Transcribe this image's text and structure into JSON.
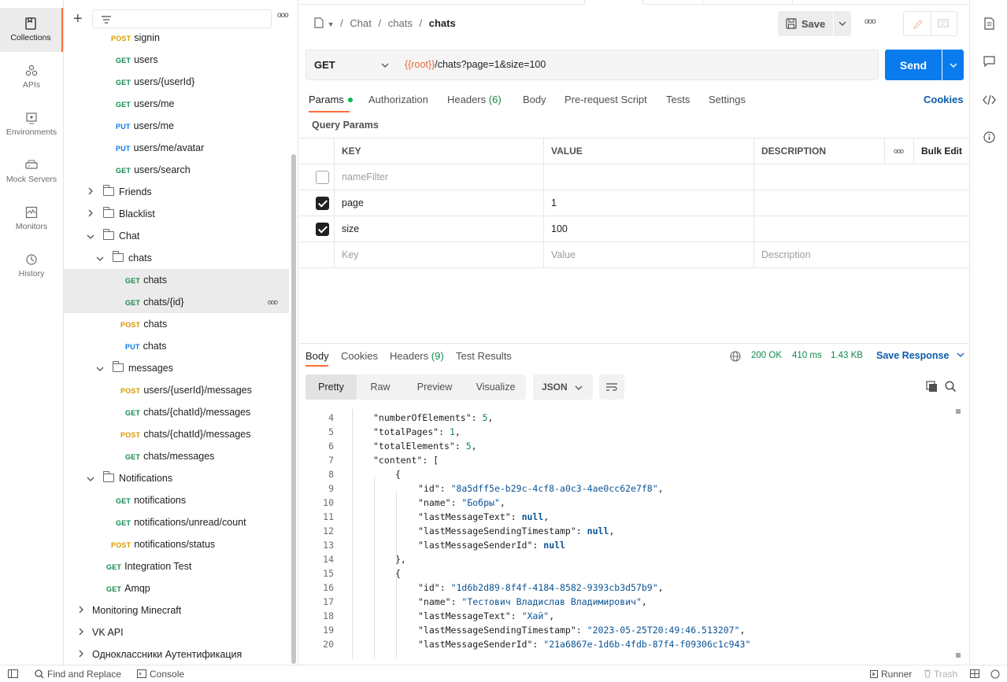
{
  "rail": [
    {
      "label": "Collections",
      "icon": "collections-icon",
      "active": true
    },
    {
      "label": "APIs",
      "icon": "apis-icon"
    },
    {
      "label": "Environments",
      "icon": "environments-icon"
    },
    {
      "label": "Mock Servers",
      "icon": "mock-servers-icon"
    },
    {
      "label": "Monitors",
      "icon": "monitors-icon"
    },
    {
      "label": "History",
      "icon": "history-icon"
    }
  ],
  "sidebar": {
    "items": [
      {
        "type": "req",
        "method": "POST",
        "name": "signin",
        "indent": 2
      },
      {
        "type": "req",
        "method": "GET",
        "name": "users",
        "indent": 2
      },
      {
        "type": "req",
        "method": "GET",
        "name": "users/{userId}",
        "indent": 2
      },
      {
        "type": "req",
        "method": "GET",
        "name": "users/me",
        "indent": 2
      },
      {
        "type": "req",
        "method": "PUT",
        "name": "users/me",
        "indent": 2
      },
      {
        "type": "req",
        "method": "PUT",
        "name": "users/me/avatar",
        "indent": 2
      },
      {
        "type": "req",
        "method": "GET",
        "name": "users/search",
        "indent": 2
      },
      {
        "type": "folder",
        "name": "Friends",
        "indent": 1,
        "open": false
      },
      {
        "type": "folder",
        "name": "Blacklist",
        "indent": 1,
        "open": false
      },
      {
        "type": "folder",
        "name": "Chat",
        "indent": 1,
        "open": true
      },
      {
        "type": "folder",
        "name": "chats",
        "indent": 2,
        "open": true
      },
      {
        "type": "req",
        "method": "GET",
        "name": "chats",
        "indent": 3,
        "selected": true
      },
      {
        "type": "req",
        "method": "GET",
        "name": "chats/{id}",
        "indent": 3,
        "selected": true,
        "more": true
      },
      {
        "type": "req",
        "method": "POST",
        "name": "chats",
        "indent": 3
      },
      {
        "type": "req",
        "method": "PUT",
        "name": "chats",
        "indent": 3
      },
      {
        "type": "folder",
        "name": "messages",
        "indent": 2,
        "open": true
      },
      {
        "type": "req",
        "method": "POST",
        "name": "users/{userId}/messages",
        "indent": 3
      },
      {
        "type": "req",
        "method": "GET",
        "name": "chats/{chatId}/messages",
        "indent": 3
      },
      {
        "type": "req",
        "method": "POST",
        "name": "chats/{chatId}/messages",
        "indent": 3
      },
      {
        "type": "req",
        "method": "GET",
        "name": "chats/messages",
        "indent": 3
      },
      {
        "type": "folder",
        "name": "Notifications",
        "indent": 1,
        "open": true
      },
      {
        "type": "req",
        "method": "GET",
        "name": "notifications",
        "indent": 2
      },
      {
        "type": "req",
        "method": "GET",
        "name": "notifications/unread/count",
        "indent": 2
      },
      {
        "type": "req",
        "method": "POST",
        "name": "notifications/status",
        "indent": 2
      },
      {
        "type": "req",
        "method": "GET",
        "name": "Integration Test",
        "indent": 1
      },
      {
        "type": "req",
        "method": "GET",
        "name": "Amqp",
        "indent": 1
      },
      {
        "type": "collection",
        "name": "Monitoring Minecraft"
      },
      {
        "type": "collection",
        "name": "VK API"
      },
      {
        "type": "collection",
        "name": "Одноклассники Аутентификация"
      }
    ]
  },
  "breadcrumb": {
    "part1": "Chat",
    "sep": "/",
    "part2": "chats",
    "part3": "chats"
  },
  "toolbar": {
    "save_label": "Save",
    "more": "ooo"
  },
  "request": {
    "method": "GET",
    "url_var": "{{root}}",
    "url_rest": "/chats?page=1&size=100",
    "send_label": "Send"
  },
  "req_tabs": {
    "params": "Params",
    "authorization": "Authorization",
    "headers": "Headers",
    "headers_count": "(6)",
    "body": "Body",
    "prerequest": "Pre-request Script",
    "tests": "Tests",
    "settings": "Settings",
    "cookies": "Cookies"
  },
  "query_params": {
    "title": "Query Params",
    "headers": {
      "key": "KEY",
      "value": "VALUE",
      "description": "DESCRIPTION",
      "more": "ooo",
      "bulk": "Bulk Edit"
    },
    "rows": [
      {
        "checked": false,
        "key": "nameFilter",
        "value": "",
        "description": "",
        "disabled": true
      },
      {
        "checked": true,
        "key": "page",
        "value": "1",
        "description": ""
      },
      {
        "checked": true,
        "key": "size",
        "value": "100",
        "description": ""
      }
    ],
    "placeholder": {
      "key": "Key",
      "value": "Value",
      "description": "Description"
    }
  },
  "response": {
    "tabs": {
      "body": "Body",
      "cookies": "Cookies",
      "headers": "Headers",
      "headers_count": "(9)",
      "tests": "Test Results"
    },
    "status": "200 OK",
    "time": "410 ms",
    "size": "1.43 KB",
    "save_response": "Save Response",
    "view_tabs": [
      "Pretty",
      "Raw",
      "Preview",
      "Visualize"
    ],
    "format": "JSON"
  },
  "code_lines": [
    {
      "n": "4",
      "indent": 1,
      "parts": [
        [
          "k",
          "\"numberOfElements\""
        ],
        [
          "p",
          ": "
        ],
        [
          "n",
          "5"
        ],
        [
          "p",
          ","
        ]
      ]
    },
    {
      "n": "5",
      "indent": 1,
      "parts": [
        [
          "k",
          "\"totalPages\""
        ],
        [
          "p",
          ": "
        ],
        [
          "n",
          "1"
        ],
        [
          "p",
          ","
        ]
      ]
    },
    {
      "n": "6",
      "indent": 1,
      "parts": [
        [
          "k",
          "\"totalElements\""
        ],
        [
          "p",
          ": "
        ],
        [
          "n",
          "5"
        ],
        [
          "p",
          ","
        ]
      ]
    },
    {
      "n": "7",
      "indent": 1,
      "parts": [
        [
          "k",
          "\"content\""
        ],
        [
          "p",
          ": ["
        ]
      ]
    },
    {
      "n": "8",
      "indent": 2,
      "parts": [
        [
          "p",
          "{"
        ]
      ]
    },
    {
      "n": "9",
      "indent": 3,
      "parts": [
        [
          "k",
          "\"id\""
        ],
        [
          "p",
          ": "
        ],
        [
          "s",
          "\"8a5dff5e-b29c-4cf8-a0c3-4ae0cc62e7f8\""
        ],
        [
          "p",
          ","
        ]
      ]
    },
    {
      "n": "10",
      "indent": 3,
      "parts": [
        [
          "k",
          "\"name\""
        ],
        [
          "p",
          ": "
        ],
        [
          "s",
          "\"Бобры\""
        ],
        [
          "p",
          ","
        ]
      ]
    },
    {
      "n": "11",
      "indent": 3,
      "parts": [
        [
          "k",
          "\"lastMessageText\""
        ],
        [
          "p",
          ": "
        ],
        [
          "nl",
          "null"
        ],
        [
          "p",
          ","
        ]
      ]
    },
    {
      "n": "12",
      "indent": 3,
      "parts": [
        [
          "k",
          "\"lastMessageSendingTimestamp\""
        ],
        [
          "p",
          ": "
        ],
        [
          "nl",
          "null"
        ],
        [
          "p",
          ","
        ]
      ]
    },
    {
      "n": "13",
      "indent": 3,
      "parts": [
        [
          "k",
          "\"lastMessageSenderId\""
        ],
        [
          "p",
          ": "
        ],
        [
          "nl",
          "null"
        ]
      ]
    },
    {
      "n": "14",
      "indent": 2,
      "parts": [
        [
          "p",
          "},"
        ]
      ]
    },
    {
      "n": "15",
      "indent": 2,
      "parts": [
        [
          "p",
          "{"
        ]
      ]
    },
    {
      "n": "16",
      "indent": 3,
      "parts": [
        [
          "k",
          "\"id\""
        ],
        [
          "p",
          ": "
        ],
        [
          "s",
          "\"1d6b2d89-8f4f-4184-8582-9393cb3d57b9\""
        ],
        [
          "p",
          ","
        ]
      ]
    },
    {
      "n": "17",
      "indent": 3,
      "parts": [
        [
          "k",
          "\"name\""
        ],
        [
          "p",
          ": "
        ],
        [
          "s",
          "\"Тестович Владислав Владимирович\""
        ],
        [
          "p",
          ","
        ]
      ]
    },
    {
      "n": "18",
      "indent": 3,
      "parts": [
        [
          "k",
          "\"lastMessageText\""
        ],
        [
          "p",
          ": "
        ],
        [
          "s",
          "\"Хай\""
        ],
        [
          "p",
          ","
        ]
      ]
    },
    {
      "n": "19",
      "indent": 3,
      "parts": [
        [
          "k",
          "\"lastMessageSendingTimestamp\""
        ],
        [
          "p",
          ": "
        ],
        [
          "s",
          "\"2023-05-25T20:49:46.513207\""
        ],
        [
          "p",
          ","
        ]
      ]
    },
    {
      "n": "20",
      "indent": 3,
      "parts": [
        [
          "k",
          "\"lastMessageSenderId\""
        ],
        [
          "p",
          ": "
        ],
        [
          "s",
          "\"21a6867e-1d6b-4fdb-87f4-f09306c1c943\""
        ]
      ]
    }
  ],
  "footer": {
    "find": "Find and Replace",
    "console": "Console",
    "runner": "Runner",
    "trash": "Trash"
  },
  "colors": {
    "accent": "#ff6c37",
    "send": "#097bed",
    "get": "#0f8a4a",
    "post": "#d99a00",
    "put": "#097bed"
  }
}
